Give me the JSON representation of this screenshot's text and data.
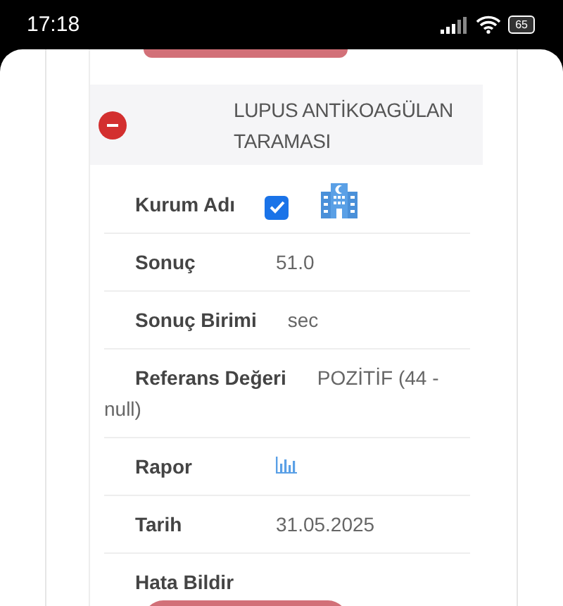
{
  "status_bar": {
    "time": "17:18",
    "battery": "65"
  },
  "header": {
    "title": "LUPUS ANTİKOAGÜLAN TARAMASI",
    "expanded": true
  },
  "fields": [
    {
      "kind": "checkbox",
      "label": "Kurum Adı",
      "checked": true
    },
    {
      "kind": "text",
      "label": "Sonuç",
      "value": "51.0"
    },
    {
      "kind": "text",
      "label": "Sonuç Birimi",
      "value": "sec"
    },
    {
      "kind": "text",
      "label": "Referans Değeri",
      "value": "POZİTİF (44 - null)"
    },
    {
      "kind": "chart",
      "label": "Rapor"
    },
    {
      "kind": "text",
      "label": "Tarih",
      "value": "31.05.2025"
    },
    {
      "kind": "label",
      "label": "Hata Bildir"
    }
  ]
}
